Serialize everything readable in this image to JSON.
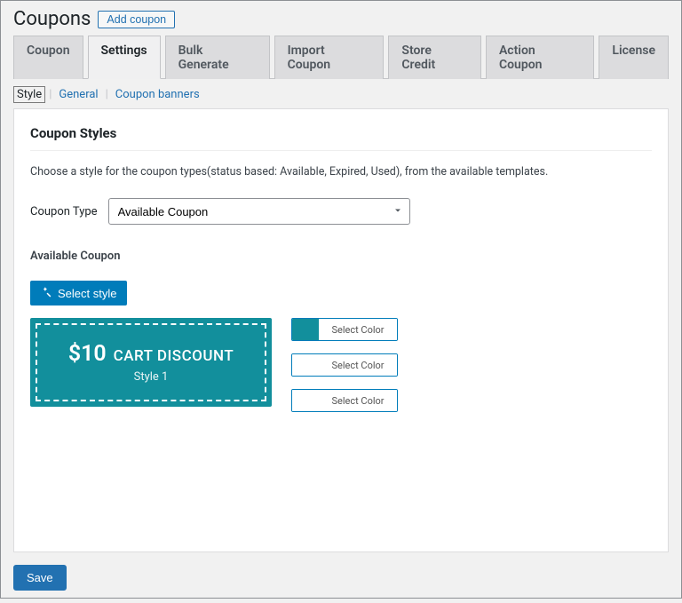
{
  "header": {
    "title": "Coupons",
    "add_button": "Add coupon"
  },
  "tabs": [
    "Coupon",
    "Settings",
    "Bulk Generate",
    "Import Coupon",
    "Store Credit",
    "Action Coupon",
    "License"
  ],
  "subtabs": [
    "Style",
    "General",
    "Coupon banners"
  ],
  "panel": {
    "heading": "Coupon Styles",
    "description": "Choose a style for the coupon types(status based: Available, Expired, Used), from the available templates.",
    "type_label": "Coupon Type",
    "type_value": "Available Coupon",
    "section_label": "Available Coupon",
    "select_style_btn": "Select style",
    "coupon_preview": {
      "amount": "$10",
      "text": "CART DISCOUNT",
      "style_name": "Style 1"
    },
    "color_buttons": [
      "Select Color",
      "Select Color",
      "Select Color"
    ]
  },
  "footer": {
    "save": "Save"
  }
}
